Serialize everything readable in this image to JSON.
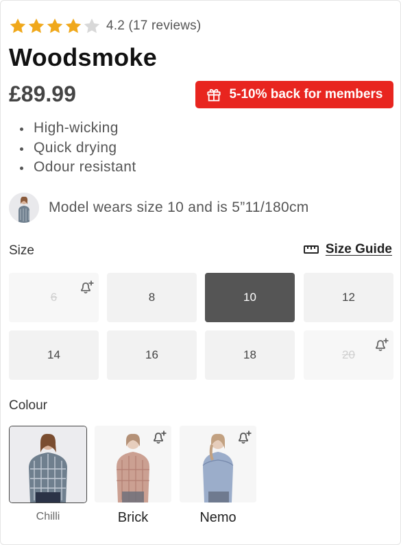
{
  "rating": {
    "stars_filled": 4,
    "stars_total": 5,
    "text": "4.2 (17 reviews)",
    "star_color": "#f0a81b",
    "empty_star_color": "#d8d8d8"
  },
  "product": {
    "name": "Woodsmoke",
    "price": "£89.99",
    "promo": "5-10% back for members",
    "promo_color": "#e8251f",
    "features": [
      "High-wicking",
      "Quick drying",
      "Odour resistant"
    ],
    "model_info": "Model wears size 10 and is 5”11/180cm"
  },
  "size": {
    "label": "Size",
    "guide_label": "Size Guide",
    "options": [
      {
        "label": "6",
        "available": false,
        "selected": false,
        "notify": true
      },
      {
        "label": "8",
        "available": true,
        "selected": false,
        "notify": false
      },
      {
        "label": "10",
        "available": true,
        "selected": true,
        "notify": false
      },
      {
        "label": "12",
        "available": true,
        "selected": false,
        "notify": false
      },
      {
        "label": "14",
        "available": true,
        "selected": false,
        "notify": false
      },
      {
        "label": "16",
        "available": true,
        "selected": false,
        "notify": false
      },
      {
        "label": "18",
        "available": true,
        "selected": false,
        "notify": false
      },
      {
        "label": "20",
        "available": false,
        "selected": false,
        "notify": true
      }
    ]
  },
  "colour": {
    "label": "Colour",
    "options": [
      {
        "name": "Chilli",
        "selected": true,
        "notify": false,
        "shirt_color": "#6f7f8e"
      },
      {
        "name": "Brick",
        "selected": false,
        "notify": true,
        "shirt_color": "#a45a43"
      },
      {
        "name": "Nemo",
        "selected": false,
        "notify": true,
        "shirt_color": "#4a6a9a"
      }
    ]
  }
}
